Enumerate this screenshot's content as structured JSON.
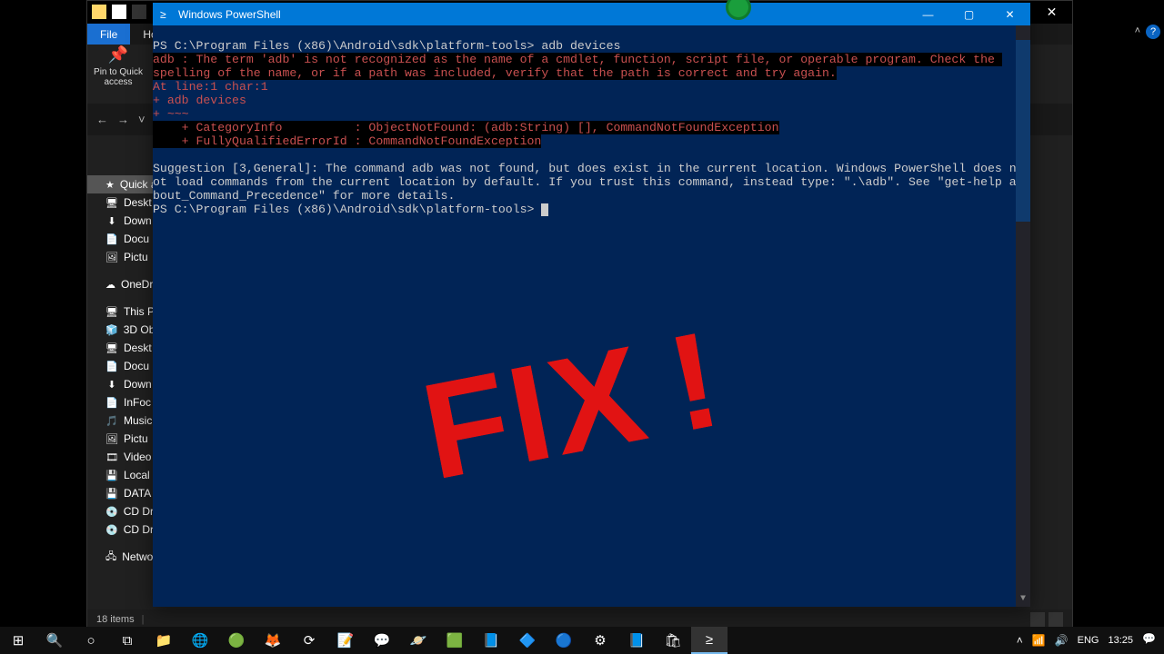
{
  "rec_indicator": "recording",
  "explorer": {
    "qat_icons": [
      "folder",
      "doc",
      "save",
      "down"
    ],
    "tabs": {
      "file": "File",
      "home": "Ho"
    },
    "pin": {
      "label1": "Pin to Quick",
      "label2": "access"
    },
    "nav": {
      "back": "←",
      "fwd": "→",
      "down": "˅"
    },
    "close_btn": "✕",
    "help": "?",
    "sidebar": {
      "quick": "Quick a",
      "items1": [
        {
          "ic": "🖥",
          "t": "Deskt"
        },
        {
          "ic": "⬇",
          "t": "Down"
        },
        {
          "ic": "📄",
          "t": "Docu"
        },
        {
          "ic": "🖼",
          "t": "Pictu"
        }
      ],
      "onedrive": {
        "ic": "☁",
        "t": "OneDri"
      },
      "thispc": {
        "ic": "🖥",
        "t": "This PC"
      },
      "items2": [
        {
          "ic": "🧊",
          "t": "3D Ob"
        },
        {
          "ic": "🖥",
          "t": "Deskt"
        },
        {
          "ic": "📄",
          "t": "Docu"
        },
        {
          "ic": "⬇",
          "t": "Down"
        },
        {
          "ic": "📄",
          "t": "InFoc"
        },
        {
          "ic": "🎵",
          "t": "Music"
        },
        {
          "ic": "🖼",
          "t": "Pictu"
        },
        {
          "ic": "🎞",
          "t": "Video"
        },
        {
          "ic": "💾",
          "t": "Local"
        },
        {
          "ic": "💾",
          "t": "DATA"
        },
        {
          "ic": "💿",
          "t": "CD Dri"
        },
        {
          "ic": "💿",
          "t": "CD Dri"
        }
      ],
      "network": {
        "ic": "🖧",
        "t": "Netwo"
      }
    },
    "status": {
      "count": "18 items"
    }
  },
  "powershell": {
    "title": "Windows PowerShell",
    "min": "—",
    "max": "▢",
    "close": "✕",
    "prompt1": "PS C:\\Program Files (x86)\\Android\\sdk\\platform-tools> ",
    "cmd1": "adb devices",
    "err1": "adb : The term 'adb' is not recognized as the name of a cmdlet, function, script file, or operable program. Check the ",
    "err2": "spelling of the name, or if a path was included, verify that the path is correct and try again.",
    "err3": "At line:1 char:1",
    "err4": "+ adb devices",
    "err5": "+ ~~~",
    "err6": "    + CategoryInfo          : ObjectNotFound: (adb:String) [], CommandNotFoundException",
    "err7": "    + FullyQualifiedErrorId : CommandNotFoundException",
    "blank": " ",
    "sug1": "Suggestion [3,General]: The command adb was not found, but does exist in the current location. Windows PowerShell does n",
    "sug2": "ot load commands from the current location by default. If you trust this command, instead type: \".\\adb\". See \"get-help a",
    "sug3": "bout_Command_Precedence\" for more details.",
    "prompt2": "PS C:\\Program Files (x86)\\Android\\sdk\\platform-tools> "
  },
  "overlay": {
    "fix": "FIX",
    "bang": "!"
  },
  "taskbar": {
    "items": [
      {
        "n": "start",
        "g": "⊞"
      },
      {
        "n": "search",
        "g": "🔍"
      },
      {
        "n": "cortana",
        "g": "○"
      },
      {
        "n": "taskview",
        "g": "⧉"
      },
      {
        "n": "explorer",
        "g": "📁"
      },
      {
        "n": "edge",
        "g": "🌐"
      },
      {
        "n": "chrome",
        "g": "🟢"
      },
      {
        "n": "firefox",
        "g": "🦊"
      },
      {
        "n": "steam",
        "g": "⟳"
      },
      {
        "n": "note",
        "g": "📝"
      },
      {
        "n": "msg",
        "g": "💬"
      },
      {
        "n": "ide",
        "g": "🪐"
      },
      {
        "n": "ide2",
        "g": "🟩"
      },
      {
        "n": "code",
        "g": "📘"
      },
      {
        "n": "app1",
        "g": "🔷"
      },
      {
        "n": "app2",
        "g": "🔵"
      },
      {
        "n": "app3",
        "g": "⚙"
      },
      {
        "n": "app4",
        "g": "📘"
      },
      {
        "n": "store",
        "g": "🛍"
      },
      {
        "n": "ps",
        "g": "≥"
      }
    ],
    "tray": {
      "up": "˄",
      "wifi": "📶",
      "vol": "🔊",
      "lang": "ENG",
      "time": "13:25",
      "notif": "💬"
    }
  }
}
